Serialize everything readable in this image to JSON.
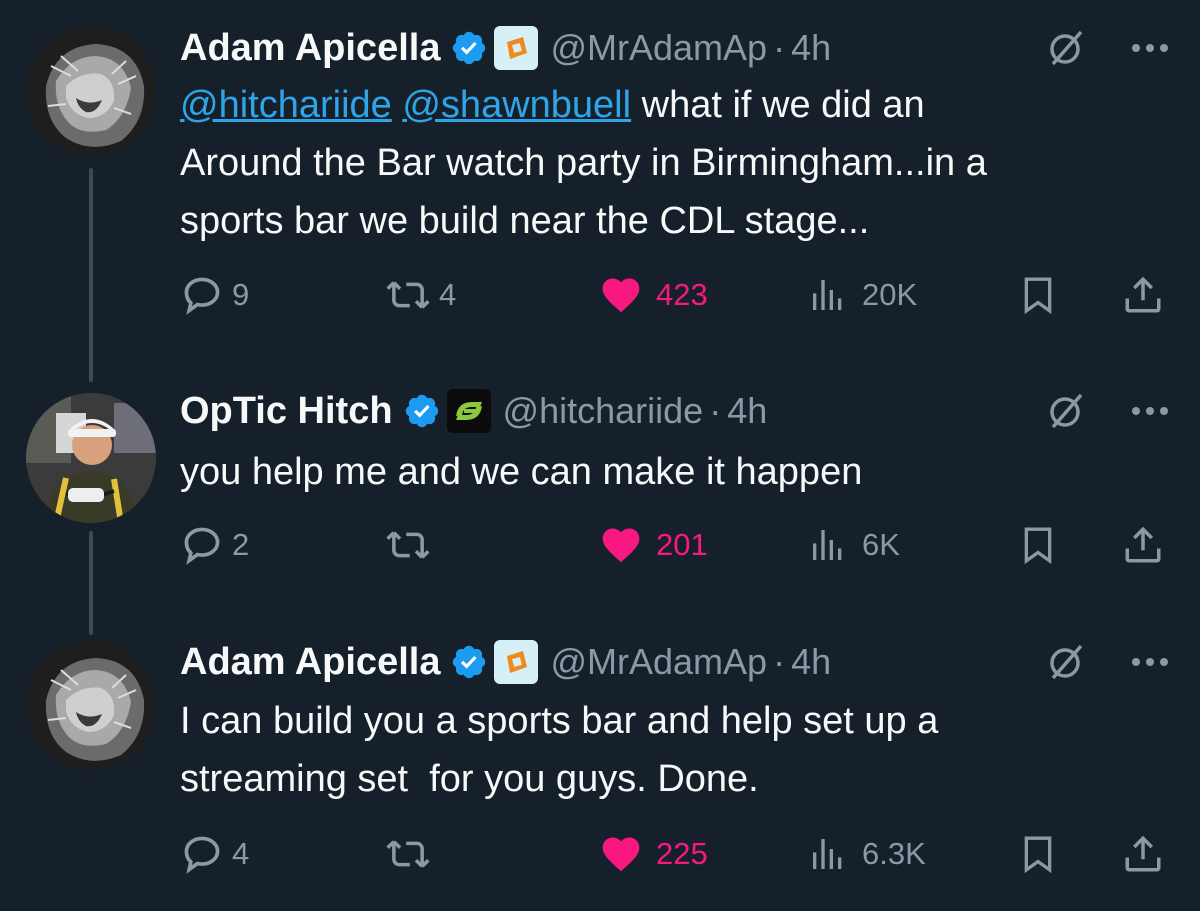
{
  "colors": {
    "background": "#15202b",
    "text": "#f7f9f9",
    "muted": "#8b98a5",
    "mention": "#2ea5e8",
    "like": "#f91880",
    "verified": "#1d9bf0",
    "thread_line": "#3d4955"
  },
  "tweets": [
    {
      "name": "Adam Apicella",
      "handle": "@MrAdamAp",
      "dot": "·",
      "time": "4h",
      "avatar": "lion-avatar",
      "affiliate_badge": "orange-brand-badge",
      "mentions": [
        "@hitchariide",
        "@shawnbuell"
      ],
      "text_lines": [
        " what if we did an",
        "Around the Bar watch party in Birmingham...in a",
        "sports bar we build near the CDL stage..."
      ],
      "replies": "9",
      "retweets": "4",
      "likes": "423",
      "views": "20K"
    },
    {
      "name": "OpTic Hitch",
      "handle": "@hitchariide",
      "dot": "·",
      "time": "4h",
      "avatar": "person-avatar",
      "affiliate_badge": "optic-green-badge",
      "text_lines": [
        "you help me and we can make it happen"
      ],
      "replies": "2",
      "retweets": "",
      "likes": "201",
      "views": "6K"
    },
    {
      "name": "Adam Apicella",
      "handle": "@MrAdamAp",
      "dot": "·",
      "time": "4h",
      "avatar": "lion-avatar",
      "affiliate_badge": "orange-brand-badge",
      "text_lines": [
        "I can build you a sports bar and help set up a",
        "streaming set  for you guys. Done."
      ],
      "replies": "4",
      "retweets": "",
      "likes": "225",
      "views": "6.3K"
    }
  ]
}
